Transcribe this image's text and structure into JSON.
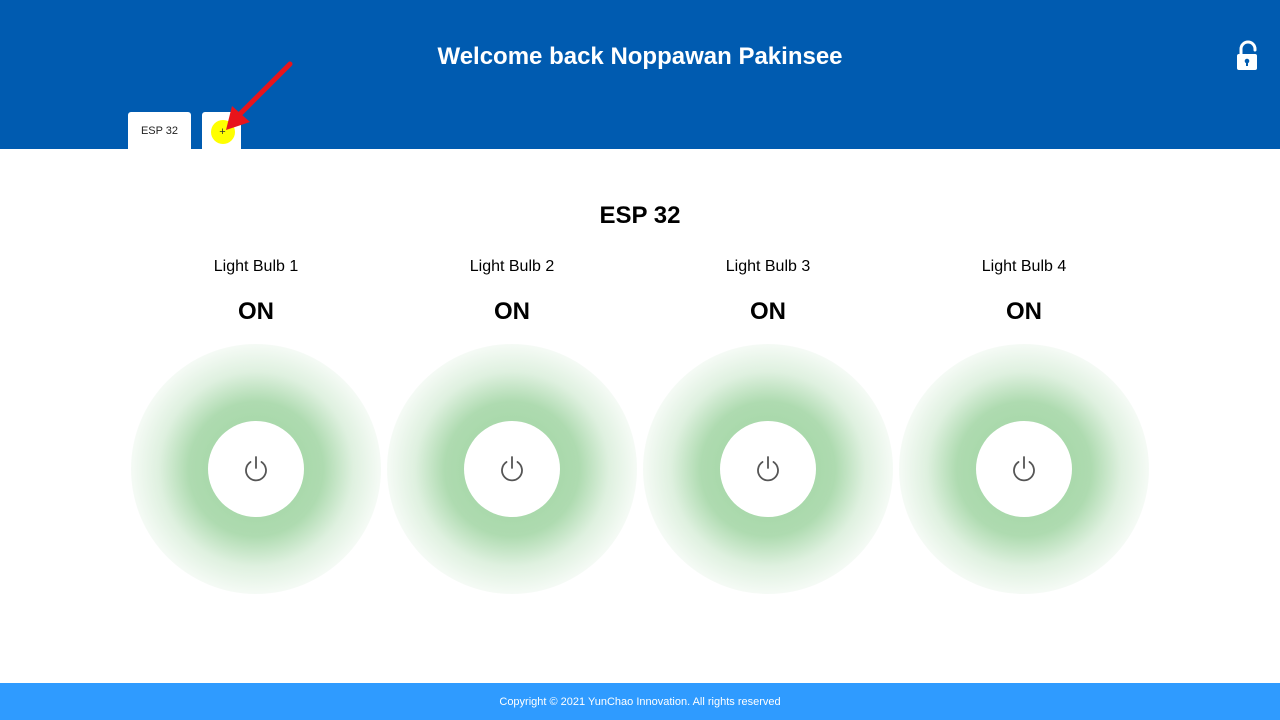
{
  "header": {
    "title": "Welcome back Noppawan Pakinsee",
    "lock_icon": "unlock-icon",
    "background": "#005bb0"
  },
  "tabs": [
    {
      "label": "ESP 32",
      "active": true
    },
    {
      "label": "+",
      "active": false
    }
  ],
  "annotation": {
    "icon": "red-arrow",
    "color": "#e8141b"
  },
  "device": {
    "title": "ESP 32",
    "bulbs": [
      {
        "label": "Light Bulb 1",
        "state": "ON",
        "icon": "power-icon"
      },
      {
        "label": "Light Bulb 2",
        "state": "ON",
        "icon": "power-icon"
      },
      {
        "label": "Light Bulb 3",
        "state": "ON",
        "icon": "power-icon"
      },
      {
        "label": "Light Bulb 4",
        "state": "ON",
        "icon": "power-icon"
      }
    ],
    "on_glow_color": "#4caf50"
  },
  "footer": {
    "text": "Copyright © 2021 YunChao Innovation. All rights reserved",
    "background": "#2f9bff"
  }
}
